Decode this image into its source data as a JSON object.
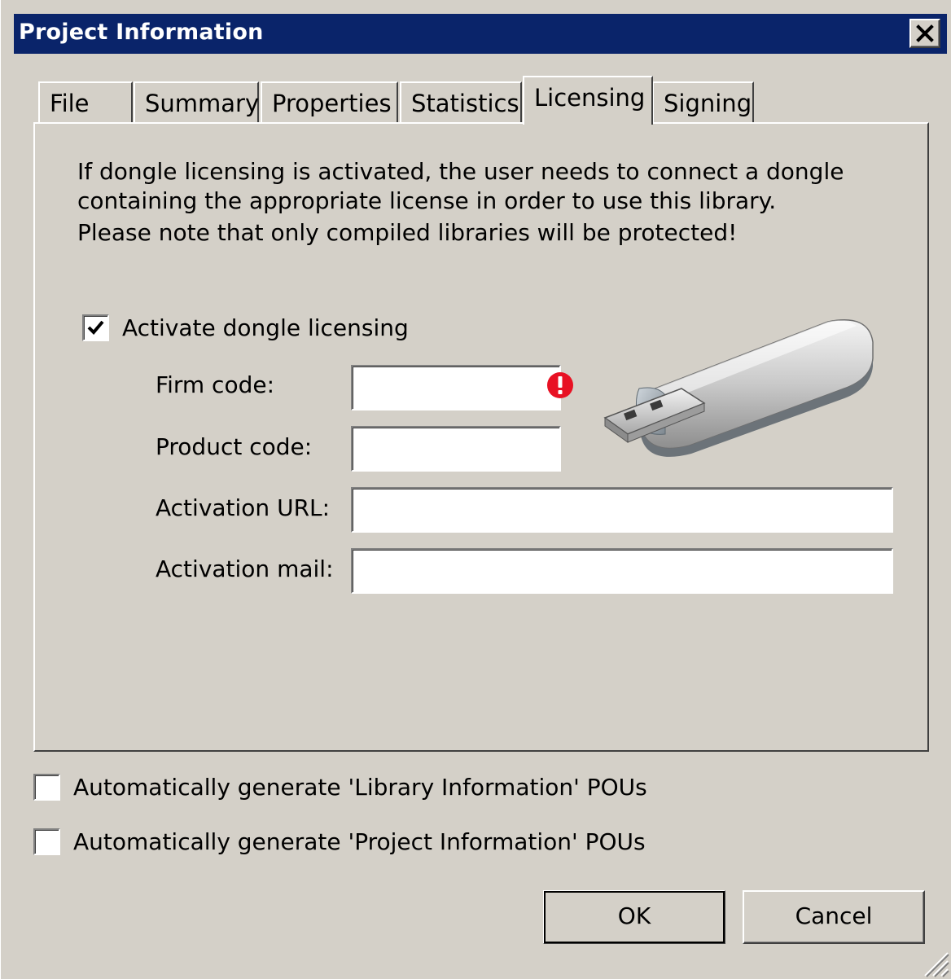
{
  "window": {
    "title": "Project Information",
    "close_label": "Close"
  },
  "tabs": [
    {
      "label": "File",
      "active": false
    },
    {
      "label": "Summary",
      "active": false
    },
    {
      "label": "Properties",
      "active": false
    },
    {
      "label": "Statistics",
      "active": false
    },
    {
      "label": "Licensing",
      "active": true
    },
    {
      "label": "Signing",
      "active": false
    }
  ],
  "licensing": {
    "info_lines": [
      "If dongle licensing is activated, the user needs to connect a dongle",
      "containing the appropriate license in order to use this library.",
      "Please note that only compiled libraries will be protected!"
    ],
    "activate_checkbox": {
      "label": "Activate dongle licensing",
      "checked": true
    },
    "firm_code": {
      "label": "Firm code:",
      "value": "",
      "has_error": true
    },
    "product_code": {
      "label": "Product code:",
      "value": ""
    },
    "activation_url": {
      "label": "Activation URL:",
      "value": ""
    },
    "activation_mail": {
      "label": "Activation mail:",
      "value": ""
    }
  },
  "options": {
    "library_info": {
      "label": "Automatically generate 'Library Information' POUs",
      "checked": false
    },
    "project_info": {
      "label": "Automatically generate 'Project Information' POUs",
      "checked": false
    }
  },
  "buttons": {
    "ok": "OK",
    "cancel": "Cancel"
  },
  "colors": {
    "titlebar": "#0a246a",
    "face": "#d4d0c8",
    "error": "#e81123"
  },
  "icons": {
    "close": "close-icon",
    "error": "error-icon",
    "dongle": "usb-dongle-icon",
    "check": "checkmark-icon",
    "grip": "resize-grip-icon"
  }
}
